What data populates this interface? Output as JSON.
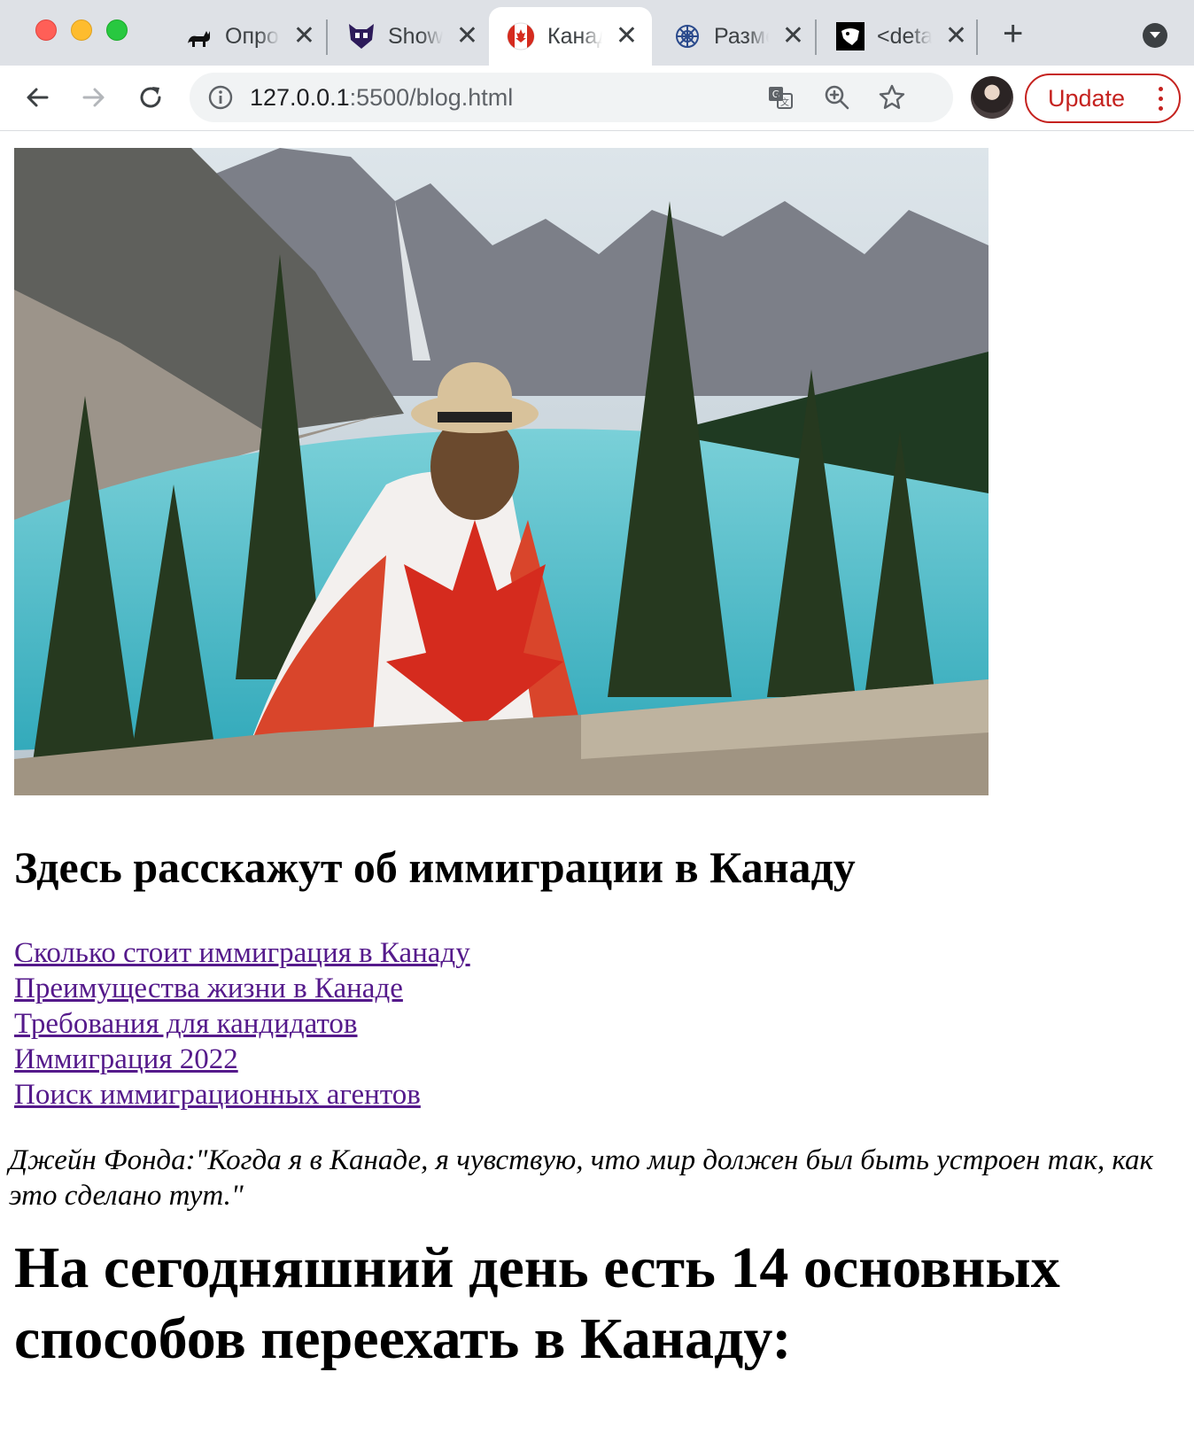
{
  "browser": {
    "tabs": [
      {
        "title": "Опрос",
        "favicon": "cat-icon",
        "active": false
      },
      {
        "title": "Show",
        "favicon": "monster-icon",
        "active": false
      },
      {
        "title": "Канада",
        "favicon": "canada-flag-icon",
        "active": true
      },
      {
        "title": "Разметка",
        "favicon": "web-icon",
        "active": false
      },
      {
        "title": "<details>",
        "favicon": "mask-icon",
        "active": false
      }
    ],
    "url_host": "127.0.0.1",
    "url_rest": ":5500/blog.html",
    "update_label": "Update",
    "accent": "#c5221f"
  },
  "page": {
    "hero_image": "Woman wrapped in Canadian flag overlooking a turquoise mountain lake",
    "subtitle": "Здесь расскажут об иммиграции в Канаду",
    "links": [
      "Сколько стоит иммиграция в Канаду",
      "Преимущества жизни в Канаде",
      "Требования для кандидатов",
      "Иммиграция 2022",
      "Поиск иммиграционных агентов"
    ],
    "quote": "Джейн Фонда:\"Когда я в Канаде, я чувствую, что мир должен был быть устроен так, как это сделано тут.\"",
    "heading": "На сегодняшний день есть 14 основных способов переехать в Канаду:",
    "link_color": "#551a8b"
  }
}
